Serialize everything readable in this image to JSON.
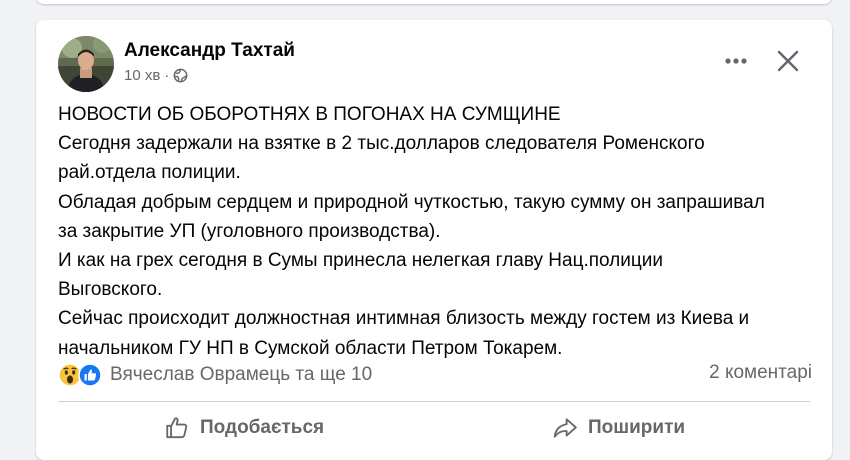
{
  "post": {
    "author": "Александр Тахтай",
    "time": "10 хв",
    "separator": "·",
    "privacy_icon": "globe-icon",
    "lines": [
      "НОВОСТИ ОБ ОБОРОТНЯХ В ПОГОНАХ НА СУМЩИНЕ",
      "Сегодня задержали на взятке в 2 тыс.долларов следователя Роменского",
      "рай.отдела полиции.",
      "Обладая добрым сердцем и природной чуткостью, такую сумму он запрашивал",
      "за закрытие УП (уголовного производства).",
      "И как на грех сегодня в Сумы принесла нелегкая главу Нац.полиции",
      "Выговского.",
      "Сейчас происходит должностная интимная близость между гостем из Киева и",
      "начальником ГУ НП в Сумской области Петром Токарем."
    ],
    "reactions": {
      "icons": [
        "wow-emoji-icon",
        "like-thumb-icon"
      ],
      "names": "Вячеслав Оврамець та ще 10"
    },
    "comments": "2 коментарі",
    "actions": {
      "like": "Подобається",
      "share": "Поширити"
    },
    "header_icons": [
      "more-dots-icon",
      "close-icon"
    ]
  },
  "colors": {
    "background": "#f0f2f5",
    "card": "#ffffff",
    "text": "#050505",
    "secondary": "#65676b",
    "like_blue": "#1877f2"
  }
}
